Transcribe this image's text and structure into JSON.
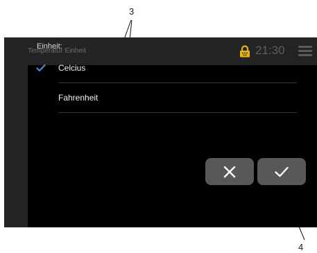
{
  "callouts": {
    "three": "3",
    "four": "4"
  },
  "header": {
    "title": "Temperatur Einheit",
    "time": "21:30"
  },
  "panel": {
    "label": "Einheit:"
  },
  "options": [
    {
      "label": "Celcius",
      "selected": true
    },
    {
      "label": "Fahrenheit",
      "selected": false
    }
  ],
  "buttons": {
    "cancel_icon": "close-icon",
    "confirm_icon": "check-icon"
  },
  "colors": {
    "lock": "#e8b800",
    "check": "#3f8fd6",
    "button": "#585858"
  }
}
